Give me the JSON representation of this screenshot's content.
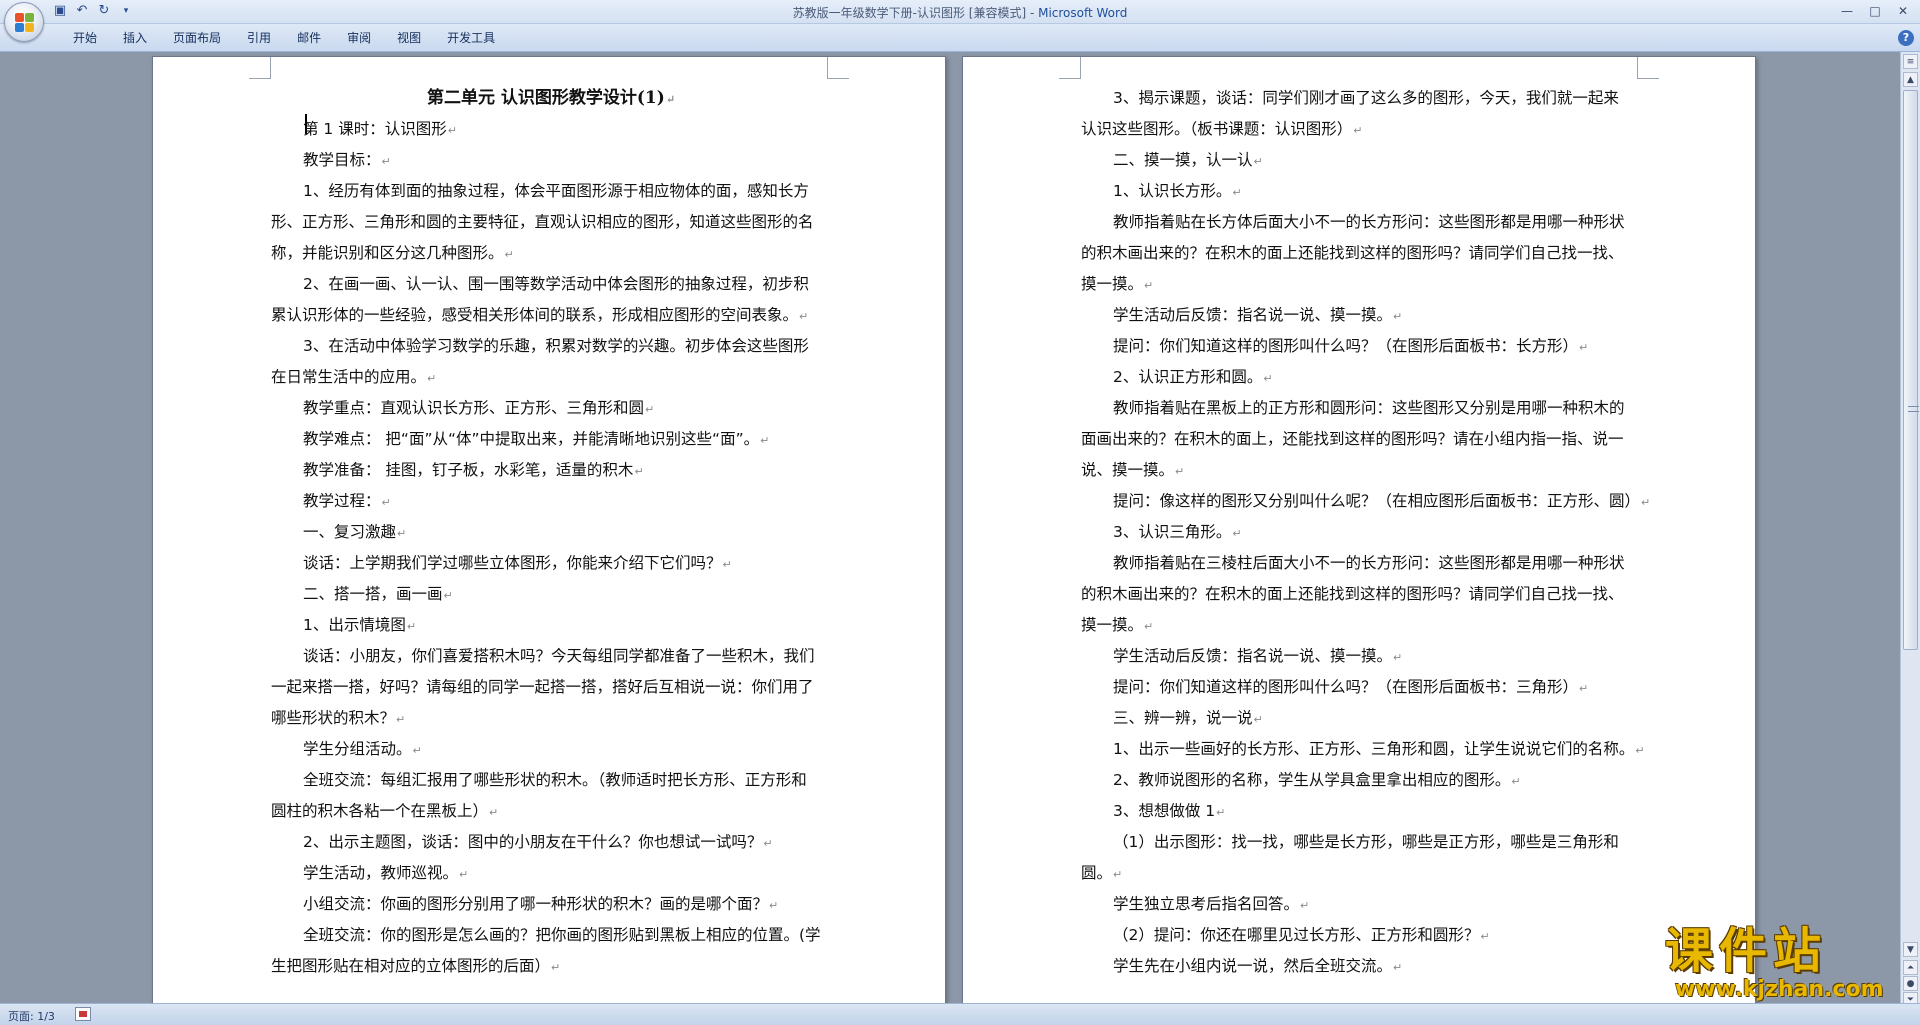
{
  "titlebar": {
    "doc_title": "苏教版一年级数学下册-认识图形 [兼容模式] - ",
    "app_name": "Microsoft Word",
    "qat_icons": [
      "save-icon",
      "undo-icon",
      "redo-icon",
      "customize-icon"
    ],
    "controls": {
      "minimize": "—",
      "maximize": "□",
      "close": "✕"
    }
  },
  "ribbon": {
    "tabs": [
      "开始",
      "插入",
      "页面布局",
      "引用",
      "邮件",
      "审阅",
      "视图",
      "开发工具"
    ]
  },
  "page_left": {
    "heading": "第二单元   认识图形教学设计(1)",
    "lines": [
      "第 1 课时：认识图形",
      "教学目标：",
      "1、经历有体到面的抽象过程，体会平面图形源于相应物体的面，感知长方",
      "形、正方形、三角形和圆的主要特征，直观认识相应的图形，知道这些图形的名",
      "称，并能识别和区分这几种图形。",
      "2、在画一画、认一认、围一围等数学活动中体会图形的抽象过程，初步积",
      "累认识形体的一些经验，感受相关形体间的联系，形成相应图形的空间表象。",
      "3、在活动中体验学习数学的乐趣，积累对数学的兴趣。初步体会这些图形",
      "在日常生活中的应用。",
      "教学重点：直观认识长方形、正方形、三角形和圆",
      "教学难点：  把“面”从“体”中提取出来，并能清晰地识别这些“面”。",
      "教学准备：  挂图，钉子板，水彩笔，适量的积木",
      "教学过程：",
      "一、复习激趣",
      "谈话：上学期我们学过哪些立体图形，你能来介绍下它们吗？",
      "二、搭一搭，画一画",
      "1、出示情境图",
      "谈话：小朋友，你们喜爱搭积木吗？今天每组同学都准备了一些积木，我们",
      "一起来搭一搭，好吗？请每组的同学一起搭一搭，搭好后互相说一说：你们用了",
      "哪些形状的积木？",
      "学生分组活动。",
      "全班交流：每组汇报用了哪些形状的积木。（教师适时把长方形、正方形和",
      "圆柱的积木各粘一个在黑板上）",
      "2、出示主题图，谈话：图中的小朋友在干什么？你也想试一试吗？",
      "学生活动，教师巡视。",
      "小组交流：你画的图形分别用了哪一种形状的积木？画的是哪个面？",
      "全班交流：你的图形是怎么画的？把你画的图形贴到黑板上相应的位置。(学",
      "生把图形贴在相对应的立体图形的后面）"
    ]
  },
  "page_right": {
    "lines": [
      "3、揭示课题，谈话：同学们刚才画了这么多的图形，今天，我们就一起来",
      "认识这些图形。（板书课题：认识图形）",
      "二、摸一摸，认一认",
      "1、认识长方形。",
      "教师指着贴在长方体后面大小不一的长方形问：这些图形都是用哪一种形状",
      "的积木画出来的？在积木的面上还能找到这样的图形吗？请同学们自己找一找、",
      "摸一摸。",
      "学生活动后反馈：指名说一说、摸一摸。",
      "提问：你们知道这样的图形叫什么吗？（在图形后面板书：长方形）",
      "2、认识正方形和圆。",
      "教师指着贴在黑板上的正方形和圆形问：这些图形又分别是用哪一种积木的",
      "面画出来的？在积木的面上，还能找到这样的图形吗？请在小组内指一指、说一",
      "说、摸一摸。",
      "提问：像这样的图形又分别叫什么呢？（在相应图形后面板书：正方形、圆）",
      "3、认识三角形。",
      "教师指着贴在三棱柱后面大小不一的长方形问：这些图形都是用哪一种形状",
      "的积木画出来的？在积木的面上还能找到这样的图形吗？请同学们自己找一找、",
      "摸一摸。",
      "学生活动后反馈：指名说一说、摸一摸。",
      "提问：你们知道这样的图形叫什么吗？（在图形后面板书：三角形）",
      "三、辨一辨，说一说",
      "1、出示一些画好的长方形、正方形、三角形和圆，让学生说说它们的名称。",
      "2、教师说图形的名称，学生从学具盒里拿出相应的图形。",
      "3、想想做做 1",
      "（1）出示图形：找一找，哪些是长方形，哪些是正方形，哪些是三角形和",
      "圆。",
      "学生独立思考后指名回答。",
      "（2）提问：你还在哪里见过长方形、正方形和圆形？",
      "学生先在小组内说一说，然后全班交流。"
    ]
  },
  "statusbar": {
    "page_info": "页面: 1/3"
  },
  "watermark": {
    "title": "课件站",
    "url": "www.kjzhan.com"
  }
}
